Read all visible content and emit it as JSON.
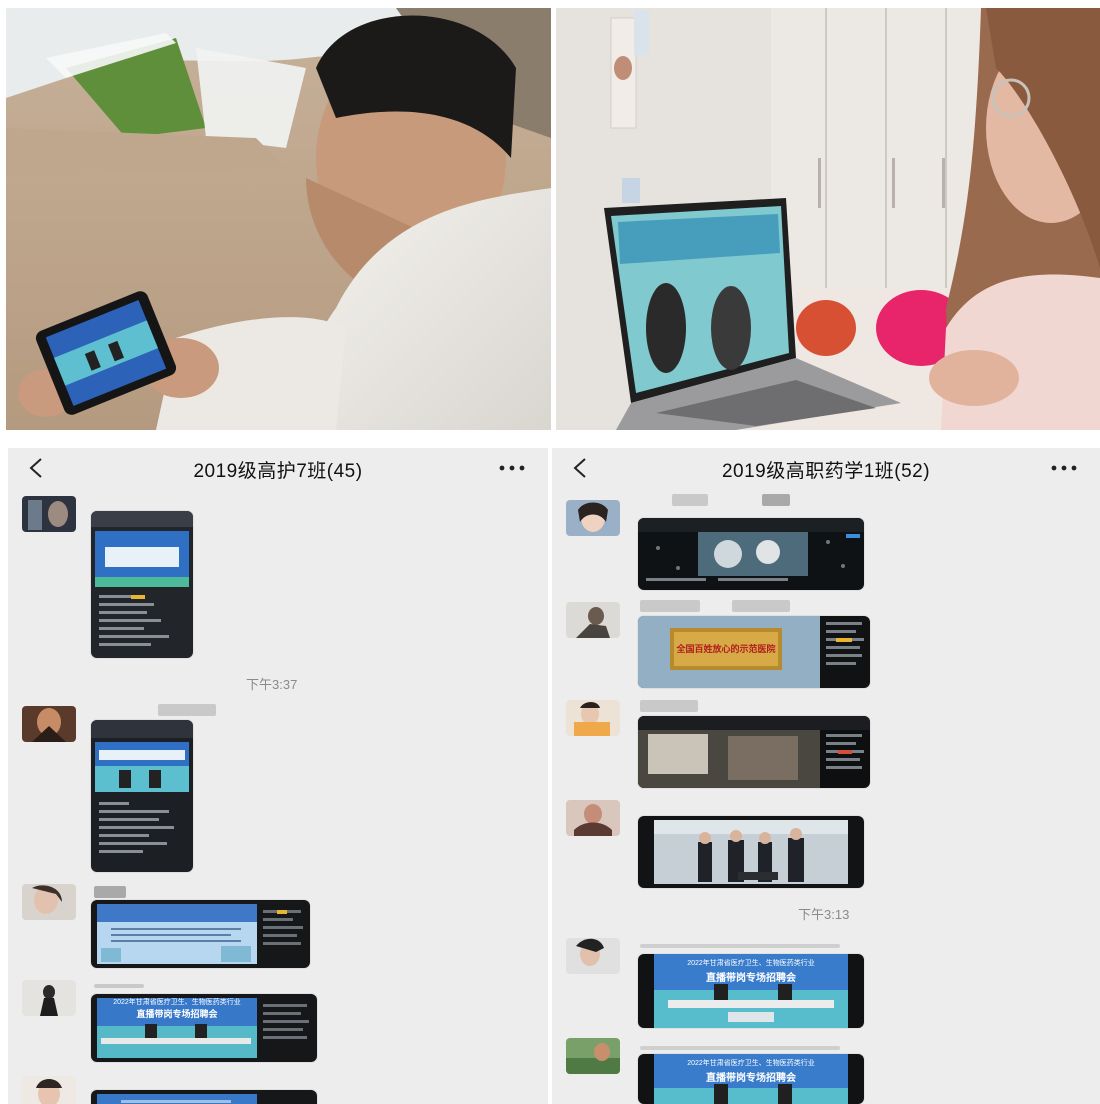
{
  "chats": [
    {
      "title": "2019级高护7班(45)",
      "timestamps": [
        "下午3:37"
      ],
      "messages": [
        {
          "thumb_title": "",
          "thumb_subtitle": ""
        },
        {
          "thumb_title": "",
          "thumb_subtitle": ""
        },
        {
          "thumb_title": "",
          "thumb_subtitle": ""
        },
        {
          "thumb_title": "2022年甘肃省医疗卫生、生物医药类行业",
          "thumb_subtitle": "直播带岗专场招聘会"
        },
        {
          "thumb_title": "",
          "thumb_subtitle": ""
        }
      ]
    },
    {
      "title": "2019级高职药学1班(52)",
      "timestamps": [
        "下午3:13"
      ],
      "messages": [
        {
          "thumb_title": "",
          "thumb_subtitle": ""
        },
        {
          "thumb_title": "全国百姓放心的示范医院",
          "thumb_subtitle": ""
        },
        {
          "thumb_title": "",
          "thumb_subtitle": ""
        },
        {
          "thumb_title": "",
          "thumb_subtitle": ""
        },
        {
          "thumb_title": "2022年甘肃省医疗卫生、生物医药类行业",
          "thumb_subtitle": "直播带岗专场招聘会"
        },
        {
          "thumb_title": "2022年甘肃省医疗卫生、生物医药类行业",
          "thumb_subtitle": "直播带岗专场招聘会"
        }
      ]
    }
  ],
  "icons": {
    "back": "chevron-left-icon",
    "more": "more-dots-icon"
  },
  "colors": {
    "chat_bg": "#ededed",
    "banner_blue": "#2e6fc7",
    "stage_teal": "#4fb8c9",
    "text": "#111111",
    "timestamp": "#8a8a8a"
  }
}
